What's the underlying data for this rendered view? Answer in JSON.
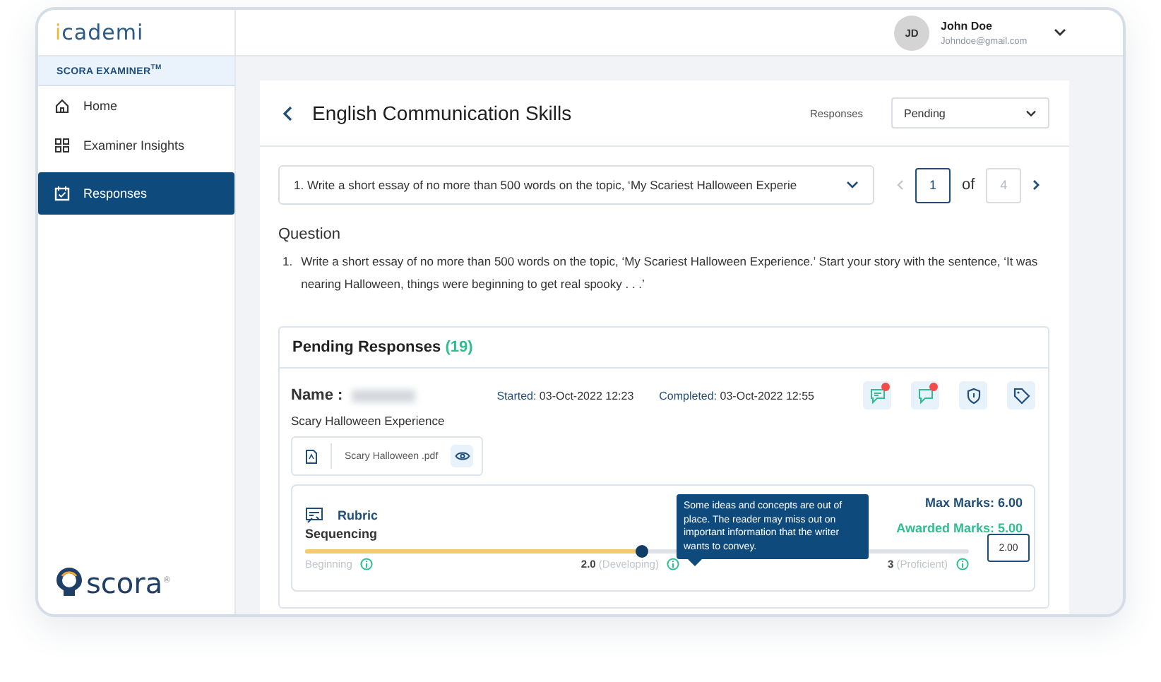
{
  "brand": {
    "logo": "icademi",
    "product": "SCORA EXAMINER$^{TM}$",
    "footer_logo": "scora$^{®}$"
  },
  "sidebar": {
    "items": [
      {
        "label": "Home",
        "kind": "home",
        "selected": false
      },
      {
        "label": "Examiner Insights",
        "kind": "grid",
        "selected": false
      },
      {
        "label": "Responses",
        "kind": "calendar",
        "selected": true
      }
    ]
  },
  "user": {
    "initials": "JD",
    "name": "John Doe",
    "email": "Johndoe@gmail.com"
  },
  "page": {
    "title": "English Communication Skills",
    "filter_label": "Responses",
    "filter_value": "Pending"
  },
  "question_select": {
    "value": "1.  Write a short essay of no more than 500 words on the topic, ‘My Scariest Halloween Experie"
  },
  "pagination": {
    "current": "1",
    "of": "of",
    "total": "4"
  },
  "question": {
    "heading": "Question",
    "number": "1.",
    "text": "Write a short essay of no more than 500 words on the topic, ‘My Scariest Halloween Experience.’ Start your story with the sentence, ‘It was nearing Halloween, things were beginning to get real spooky . . .’"
  },
  "pending": {
    "title": "Pending Responses",
    "count": "(19)"
  },
  "response": {
    "name_label": "Name :",
    "started_label": "Started:",
    "started": "03-Oct-2022 12:23",
    "completed_label": "Completed:",
    "completed": "03-Oct-2022 12:55",
    "actions": [
      {
        "kind": "comment-text",
        "badge": true
      },
      {
        "kind": "comment",
        "badge": true
      },
      {
        "kind": "shield",
        "badge": false
      },
      {
        "kind": "tag",
        "badge": false
      }
    ],
    "essay_title": "Scary Halloween Experience",
    "file": "Scary Halloween .pdf"
  },
  "rubric": {
    "title": "Rubric",
    "max_marks": "Max Marks: 6.00",
    "awarded_marks": "Awarded Marks: 5.00",
    "criterion": "Sequencing",
    "level": 0.506,
    "scale": [
      {
        "label": "Beginning"
      },
      {
        "score": "2.0",
        "label": "(Developing)"
      },
      {
        "score": "3",
        "label": "(Proficient)"
      }
    ],
    "tooltip": "Some ideas and concepts are out of place. The reader may miss out on important information that the writer wants to convey.",
    "mark": "2.00"
  }
}
